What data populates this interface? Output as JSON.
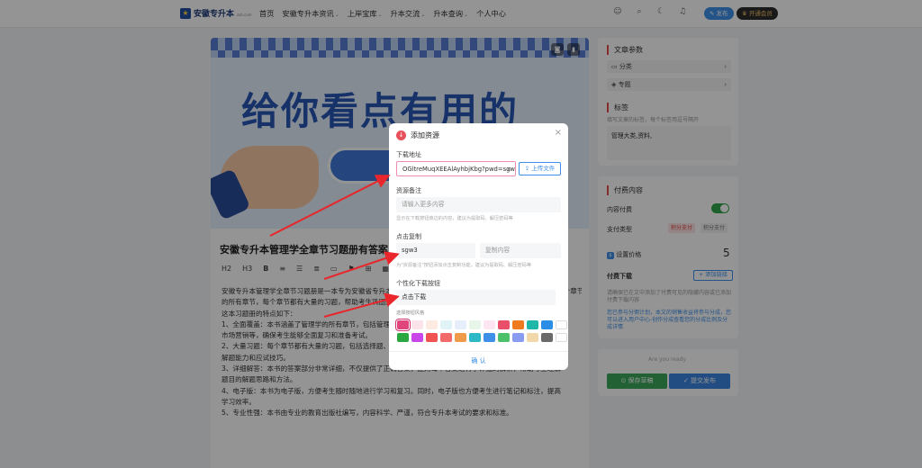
{
  "header": {
    "logo_text": "安徽专升本",
    "logo_sub": "zsb.com",
    "nav": [
      {
        "label": "首页",
        "has_menu": false
      },
      {
        "label": "安徽专升本资讯",
        "has_menu": true
      },
      {
        "label": "上岸宝库",
        "has_menu": true
      },
      {
        "label": "升本交流",
        "has_menu": true
      },
      {
        "label": "升本查询",
        "has_menu": true
      },
      {
        "label": "个人中心",
        "has_menu": false
      }
    ],
    "publish_label": "发布",
    "vip_label": "开通会员"
  },
  "article": {
    "banner_text": "给你看点有用的",
    "title": "安徽专升本管理学全章节习题册有答案",
    "toolbar": [
      "H2",
      "H3",
      "B",
      "≡",
      "☰",
      "≣",
      "▭",
      "⚑",
      "⊞",
      "▦",
      "☐",
      "⌁"
    ],
    "paragraphs": [
      "安徽专升本管理学全章节习题册是一本专为安徽省专升本考生打造的复习资料，全面涵盖了管理学的所有章节，每个章节都有大量的习题，",
      "的所有章节，每个章节都有大量的习题，帮助考生巩固知识点，提高解题能力，以应对专升本考试。",
      "这本习题册的特点如下：",
      "1、全面覆盖：本书涵盖了管理学的所有章节，包括管理理论、计划、组织、领导、控制、决策、",
      "市场营销等，确保考生能够全面复习和准备考试。",
      "2、大量习题：每个章节都有大量的习题，包括选择题、判断题、简答题、论述题等多种题型，有助于考生提高",
      "解题能力和应试技巧。",
      "3、详细解答：本书的答案部分非常详细，不仅提供了正确答案，还对每个答案进行了详细的解析，帮助考生理解",
      "题目的解题思路和方法。",
      "4、电子版：本书为电子版，方便考生随时随地进行学习和复习。同时，电子版也方便考生进行笔记和标注，提高",
      "学习效率。",
      "5、专业性强：本书由专业的教育出版社编写，内容科学、严谨，符合专升本考试的要求和标准。"
    ]
  },
  "sidebar": {
    "params_title": "文章参数",
    "category_label": "分类",
    "topic_label": "专题",
    "tags_title": "标签",
    "tags_hint": "填写文章的标签，每个标签用逗号隔开",
    "tags_value": "管理大类,资料,",
    "paid_title": "付费内容",
    "content_paid_label": "内容付费",
    "pay_type_label": "支付类型",
    "pay_type_options": [
      "积分支付",
      "积分支付"
    ],
    "price_label": "设置价格",
    "price_value": "5",
    "paid_download_label": "付费下载",
    "add_link_label": "+ 添加链接",
    "paid_hint": "请确保已在文中添加了付费可见的隐藏内容或已添加付费下载内容",
    "paid_note": "您已参与分佣计划，本文的销售收益将参与分成，您可以进入用户中心-创作分成查看您的分成比例及分成详情",
    "ready_label": "Are you ready",
    "save_draft_label": "保存草稿",
    "submit_label": "提交发布"
  },
  "modal": {
    "title": "添加资源",
    "download_label": "下载地址",
    "download_value": "OGltreMuqXEEAlAyhbjKbg?pwd=sgw3",
    "upload_label": "上传文件",
    "note_label": "资源备注",
    "note_placeholder": "请输入更多内容",
    "note_hint": "显示在下载按钮旁边的内容，建议为提取码、解压密码等",
    "copy_label": "点击复制",
    "copy_value": "sgw3",
    "copy_placeholder": "复制内容",
    "copy_hint": "为\"资源备注\"按钮添加点击复制功能，建议为提取码、解压密码等",
    "custom_label": "个性化下载按钮",
    "custom_value": "点击下载",
    "style_label": "选择按钮风格",
    "swatches": [
      "#e0457b",
      "#fbe3ea",
      "#fdebe1",
      "#e0f4f7",
      "#e6eefb",
      "#e8f6ea",
      "#fde6f2",
      "#ea4f6a",
      "#f07a1f",
      "#20b7a8",
      "#2b8ee6",
      "#ffffff",
      "#2aa83f",
      "#c946e8",
      "#f05252",
      "#f26a6a",
      "#f09b4a",
      "#2db8c8",
      "#3d8fe8",
      "#4cc06a",
      "#8a9bf2",
      "#f2d8a8",
      "#6a6a6a",
      "#ffffff"
    ],
    "confirm_label": "确 认"
  }
}
